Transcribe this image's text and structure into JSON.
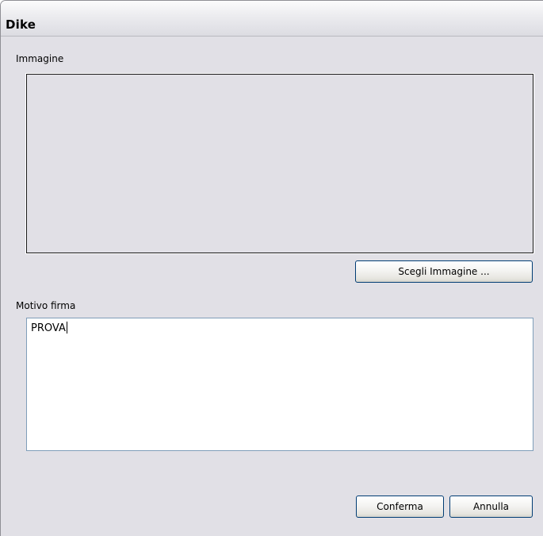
{
  "window": {
    "title": "Dike"
  },
  "image_section": {
    "label": "Immagine",
    "choose_button_label": "Scegli Immagine ..."
  },
  "reason_section": {
    "label": "Motivo firma",
    "value": "PROVA"
  },
  "footer": {
    "confirm_label": "Conferma",
    "cancel_label": "Annulla"
  }
}
